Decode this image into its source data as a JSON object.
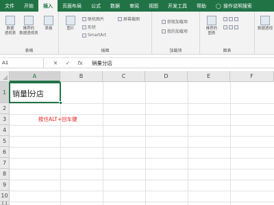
{
  "tabs": [
    "文件",
    "开始",
    "插入",
    "页面布局",
    "公式",
    "数据",
    "审阅",
    "视图",
    "开发工具",
    "帮助",
    "操作说明搜索"
  ],
  "active_tab": "插入",
  "ribbon": {
    "pivot_label": "数据\n透视表",
    "rec_pivot_label": "推荐的\n数据透视表",
    "table_label": "表格",
    "tables_group": "表格",
    "picture_label": "图片",
    "online_picture": "联机图片",
    "shapes": "形状",
    "smartart": "SmartArt",
    "screenshot": "屏幕截图",
    "illustrations_group": "插图",
    "get_addins": "获取加载项",
    "my_addins": "我的加载项",
    "addins_group": "加载项",
    "rec_charts": "推荐的\n图表",
    "charts_group": "图表",
    "pivot_chart": "数据透视"
  },
  "formula_bar": {
    "name_box": "A1",
    "cancel": "✕",
    "enter": "✓",
    "fx": "fx",
    "content": "销量分店"
  },
  "columns": [
    "A",
    "B",
    "C",
    "D",
    "E",
    "F"
  ],
  "rows": [
    "1",
    "2",
    "3",
    "4",
    "5",
    "6",
    "7",
    "8",
    "9",
    "10",
    "11"
  ],
  "cell_a1": {
    "before_cursor": "销量",
    "after_cursor": "分店"
  },
  "hint_text": "按住ALT+回车键",
  "colors": {
    "accent": "#217346",
    "hint": "#e02020"
  }
}
